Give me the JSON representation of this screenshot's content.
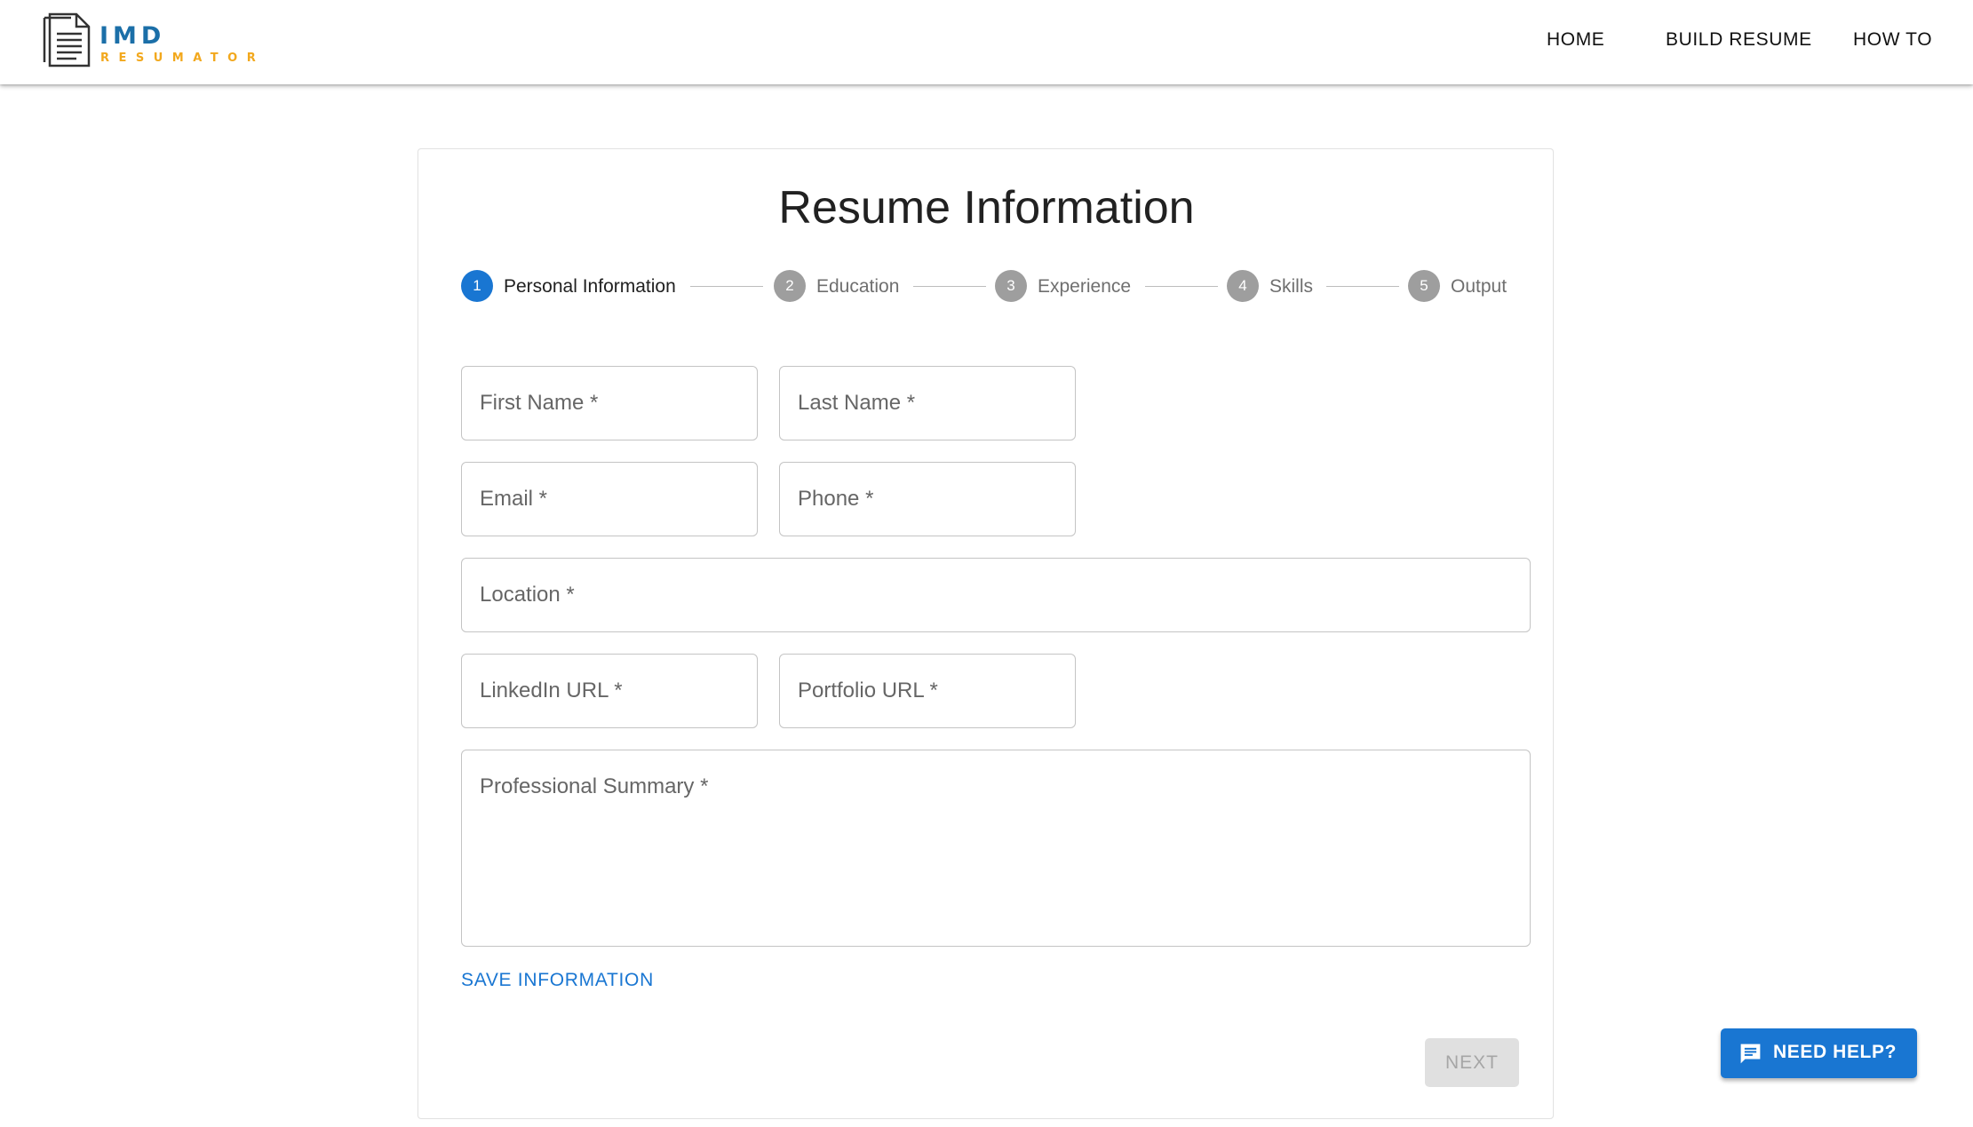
{
  "brand": {
    "name": "IMD",
    "tagline": "RESUMATOR",
    "primary_color": "#1b6fa8",
    "accent_color": "#f2a81d",
    "icon": "document-icon"
  },
  "nav": {
    "home": "HOME",
    "build_resume": "BUILD RESUME",
    "how_to": "HOW TO"
  },
  "card": {
    "title": "Resume Information"
  },
  "stepper": {
    "active_step": 1,
    "steps": [
      {
        "number": "1",
        "label": "Personal Information"
      },
      {
        "number": "2",
        "label": "Education"
      },
      {
        "number": "3",
        "label": "Experience"
      },
      {
        "number": "4",
        "label": "Skills"
      },
      {
        "number": "5",
        "label": "Output"
      }
    ]
  },
  "form": {
    "first_name": {
      "label": "First Name *",
      "value": ""
    },
    "last_name": {
      "label": "Last Name *",
      "value": ""
    },
    "email": {
      "label": "Email *",
      "value": ""
    },
    "phone": {
      "label": "Phone *",
      "value": ""
    },
    "location": {
      "label": "Location *",
      "value": ""
    },
    "linkedin_url": {
      "label": "LinkedIn URL *",
      "value": ""
    },
    "portfolio_url": {
      "label": "Portfolio URL *",
      "value": ""
    },
    "professional_summary": {
      "label": "Professional Summary *",
      "value": ""
    }
  },
  "actions": {
    "save": "SAVE INFORMATION",
    "next": "NEXT",
    "next_disabled": true
  },
  "help": {
    "label": "NEED HELP?",
    "icon": "chat-icon",
    "color": "#1976d2"
  }
}
